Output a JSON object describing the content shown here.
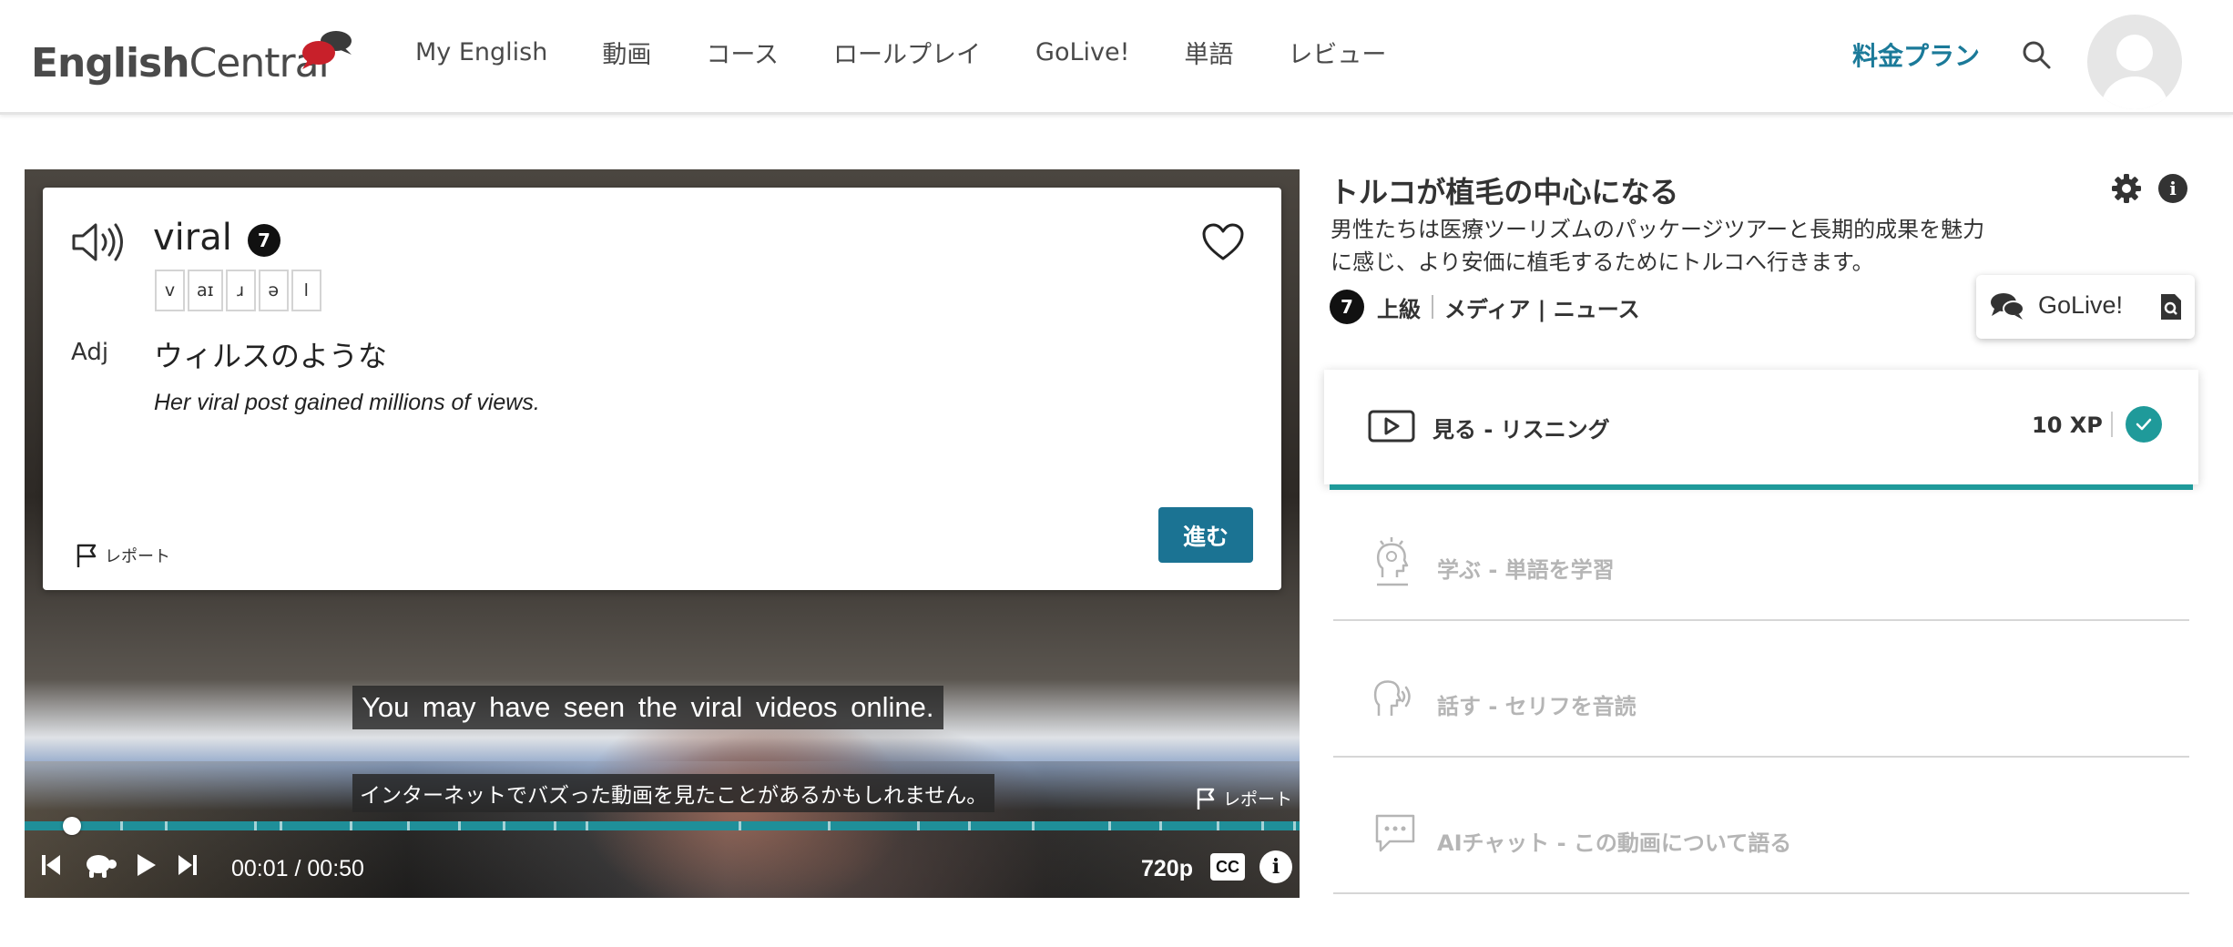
{
  "header": {
    "logo_bold": "English",
    "logo_light": "Central",
    "nav": [
      "My English",
      "動画",
      "コース",
      "ロールプレイ",
      "GoLive!",
      "単語",
      "レビュー"
    ],
    "plan_link": "料金プラン",
    "icons": {
      "search": "search-icon",
      "avatar": "user-avatar"
    },
    "colors": {
      "accent": "#1b7a99",
      "logo_bubble_red": "#c8202a",
      "logo_bubble_dark": "#3a3a3a"
    }
  },
  "word_card": {
    "word": "viral",
    "level": "7",
    "phonemes": [
      "v",
      "aɪ",
      "ɹ",
      "ə",
      "l"
    ],
    "part_of_speech": "Adj",
    "definition": "ウィルスのような",
    "example": "Her viral post gained millions of views.",
    "report_label": "レポート",
    "proceed_label": "進む",
    "icons": {
      "audio": "speaker-icon",
      "favorite": "heart-icon",
      "report": "flag-icon"
    }
  },
  "player": {
    "subtitle_en": "You may have seen the viral videos online.",
    "subtitle_jp": "インターネットでバズった動画を見たことがあるかもしれません。",
    "report_label": "レポート",
    "current_time": "00:01",
    "duration": "00:50",
    "time_display": "00:01 / 00:50",
    "quality": "720p",
    "cc_label": "CC",
    "info_label": "i",
    "progress_fraction": 0.02,
    "colors": {
      "progress": "#1f8f99",
      "proceed_button": "#1b7393"
    }
  },
  "lesson": {
    "title": "トルコが植毛の中心になる",
    "description": "男性たちは医療ツーリズムのパッケージツアーと長期的成果を魅力に感じ、より安価に植毛するためにトルコへ行きます。",
    "level": "7",
    "level_name": "上級",
    "category": "メディア | ニュース",
    "golive_label": "GoLive!",
    "info_label": "i",
    "steps": [
      {
        "label": "見る - リスニング",
        "xp": "10 XP",
        "completed": true,
        "icon": "play-video-icon"
      },
      {
        "label": "学ぶ - 単語を学習",
        "icon": "lightbulb-head-icon"
      },
      {
        "label": "話す - セリフを音読",
        "icon": "speaking-head-icon"
      },
      {
        "label": "AIチャット - この動画について語る",
        "icon": "chat-bubble-icon"
      }
    ],
    "colors": {
      "step_done": "#1f9a9a",
      "step_inactive_text": "#b5b5b5"
    }
  }
}
